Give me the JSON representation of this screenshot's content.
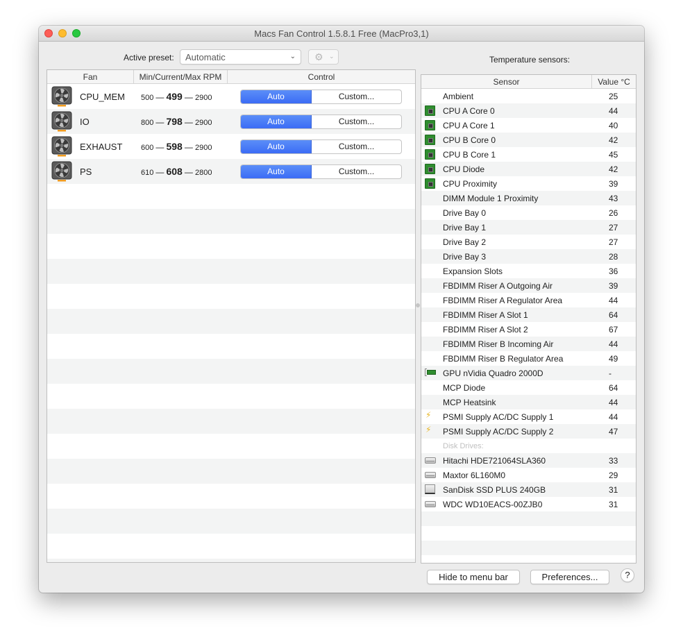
{
  "window": {
    "title": "Macs Fan Control 1.5.8.1 Free (MacPro3,1)"
  },
  "preset": {
    "label": "Active preset:",
    "selected": "Automatic",
    "chevron": "⌄",
    "gear_icon": "⚙",
    "gear_chevron": "⌄"
  },
  "fan_table": {
    "columns": [
      "Fan",
      "Min/Current/Max RPM",
      "Control"
    ],
    "rows": [
      {
        "name": "CPU_MEM",
        "min": "500",
        "current": "499",
        "max": "2900",
        "mode_auto": "Auto",
        "mode_custom": "Custom...",
        "selected": "Auto"
      },
      {
        "name": "IO",
        "min": "800",
        "current": "798",
        "max": "2900",
        "mode_auto": "Auto",
        "mode_custom": "Custom...",
        "selected": "Auto"
      },
      {
        "name": "EXHAUST",
        "min": "600",
        "current": "598",
        "max": "2900",
        "mode_auto": "Auto",
        "mode_custom": "Custom...",
        "selected": "Auto"
      },
      {
        "name": "PS",
        "min": "610",
        "current": "608",
        "max": "2800",
        "mode_auto": "Auto",
        "mode_custom": "Custom...",
        "selected": "Auto"
      }
    ],
    "dash": "—"
  },
  "sensors": {
    "label": "Temperature sensors:",
    "columns": [
      "Sensor",
      "Value °C"
    ],
    "rows": [
      {
        "name": "Ambient",
        "value": "25",
        "icon": "none"
      },
      {
        "name": "CPU A Core 0",
        "value": "44",
        "icon": "cpu-chip"
      },
      {
        "name": "CPU A Core 1",
        "value": "40",
        "icon": "cpu-chip"
      },
      {
        "name": "CPU B Core 0",
        "value": "42",
        "icon": "cpu-chip"
      },
      {
        "name": "CPU B Core 1",
        "value": "45",
        "icon": "cpu-chip"
      },
      {
        "name": "CPU Diode",
        "value": "42",
        "icon": "cpu-chip"
      },
      {
        "name": "CPU Proximity",
        "value": "39",
        "icon": "cpu-chip"
      },
      {
        "name": "DIMM Module 1 Proximity",
        "value": "43",
        "icon": "none"
      },
      {
        "name": "Drive Bay 0",
        "value": "26",
        "icon": "none"
      },
      {
        "name": "Drive Bay 1",
        "value": "27",
        "icon": "none"
      },
      {
        "name": "Drive Bay 2",
        "value": "27",
        "icon": "none"
      },
      {
        "name": "Drive Bay 3",
        "value": "28",
        "icon": "none"
      },
      {
        "name": "Expansion Slots",
        "value": "36",
        "icon": "none"
      },
      {
        "name": "FBDIMM Riser A Outgoing Air",
        "value": "39",
        "icon": "none"
      },
      {
        "name": "FBDIMM Riser A Regulator Area",
        "value": "44",
        "icon": "none"
      },
      {
        "name": "FBDIMM Riser A Slot 1",
        "value": "64",
        "icon": "none"
      },
      {
        "name": "FBDIMM Riser A Slot 2",
        "value": "67",
        "icon": "none"
      },
      {
        "name": "FBDIMM Riser B Incoming Air",
        "value": "44",
        "icon": "none"
      },
      {
        "name": "FBDIMM Riser B Regulator Area",
        "value": "49",
        "icon": "none"
      },
      {
        "name": "GPU nVidia Quadro 2000D",
        "value": "-",
        "icon": "gpu-card"
      },
      {
        "name": "MCP Diode",
        "value": "64",
        "icon": "none"
      },
      {
        "name": "MCP Heatsink",
        "value": "44",
        "icon": "none"
      },
      {
        "name": "PSMI Supply AC/DC Supply 1",
        "value": "44",
        "icon": "power-bolt"
      },
      {
        "name": "PSMI Supply AC/DC Supply 2",
        "value": "47",
        "icon": "power-bolt"
      },
      {
        "name": "Disk Drives:",
        "value": "",
        "icon": "section"
      },
      {
        "name": "Hitachi HDE721064SLA360",
        "value": "33",
        "icon": "hard-drive"
      },
      {
        "name": "Maxtor 6L160M0",
        "value": "29",
        "icon": "hard-drive"
      },
      {
        "name": "SanDisk SSD PLUS 240GB",
        "value": "31",
        "icon": "ssd-drive"
      },
      {
        "name": "WDC WD10EACS-00ZJB0",
        "value": "31",
        "icon": "hard-drive"
      }
    ]
  },
  "buttons": {
    "hide": "Hide to menu bar",
    "preferences": "Preferences...",
    "help": "?"
  }
}
